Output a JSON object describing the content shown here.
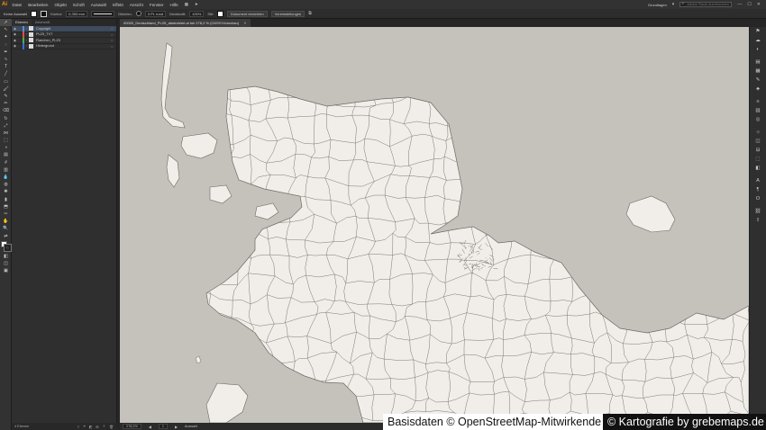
{
  "app": {
    "logo": "Ai"
  },
  "menu": [
    "Datei",
    "Bearbeiten",
    "Objekt",
    "Schrift",
    "Auswahl",
    "Effekt",
    "Ansicht",
    "Fenster",
    "Hilfe"
  ],
  "menubar_right": {
    "workspace": "Grundlagen",
    "search_placeholder": "Adobe Stock durchsuchen"
  },
  "controlbar": {
    "selection_label": "Keine Auswahl",
    "stroke_label": "Kontur:",
    "stroke_value": "0,353 mm",
    "stroke_style": "Gleichm.",
    "brush": "3 Pt. rund",
    "style": "Standard",
    "opacity_label": "Deckkraft:",
    "opacity_value": "100%",
    "style_label": "Stil:",
    "doc_setup": "Dokument einrichten",
    "preferences": "Voreinstellungen"
  },
  "layers_panel": {
    "tabs": [
      "Ebenen",
      "Zeichenfl."
    ],
    "active_tab": 0,
    "layers": [
      {
        "name": "Copyright",
        "color": "#4f8fe6",
        "selected": true
      },
      {
        "name": "PLZ5_TXT",
        "color": "#e34a4a",
        "selected": false
      },
      {
        "name": "Flaechen_PLZ5",
        "color": "#43b34a",
        "selected": false
      },
      {
        "name": "Hintergrund",
        "color": "#3a6de0",
        "selected": false
      }
    ],
    "footer_count": "4 Ebenen"
  },
  "document": {
    "tab_title": "00000_Deutschland_PLZ5_abstrahiert.ai bei 278,2 % (CMYK/Vorschau)",
    "zoom": "278,2%",
    "artboard": "1",
    "tool_name": "Auswahl"
  },
  "map": {
    "water_color": "#c5c1bb",
    "land_color": "#f1eee9",
    "line_color": "#6d6a66"
  },
  "credits": {
    "osm": "Basisdaten © OpenStreetMap-Mitwirkende",
    "carto": "© Kartografie by grebemaps.de"
  }
}
